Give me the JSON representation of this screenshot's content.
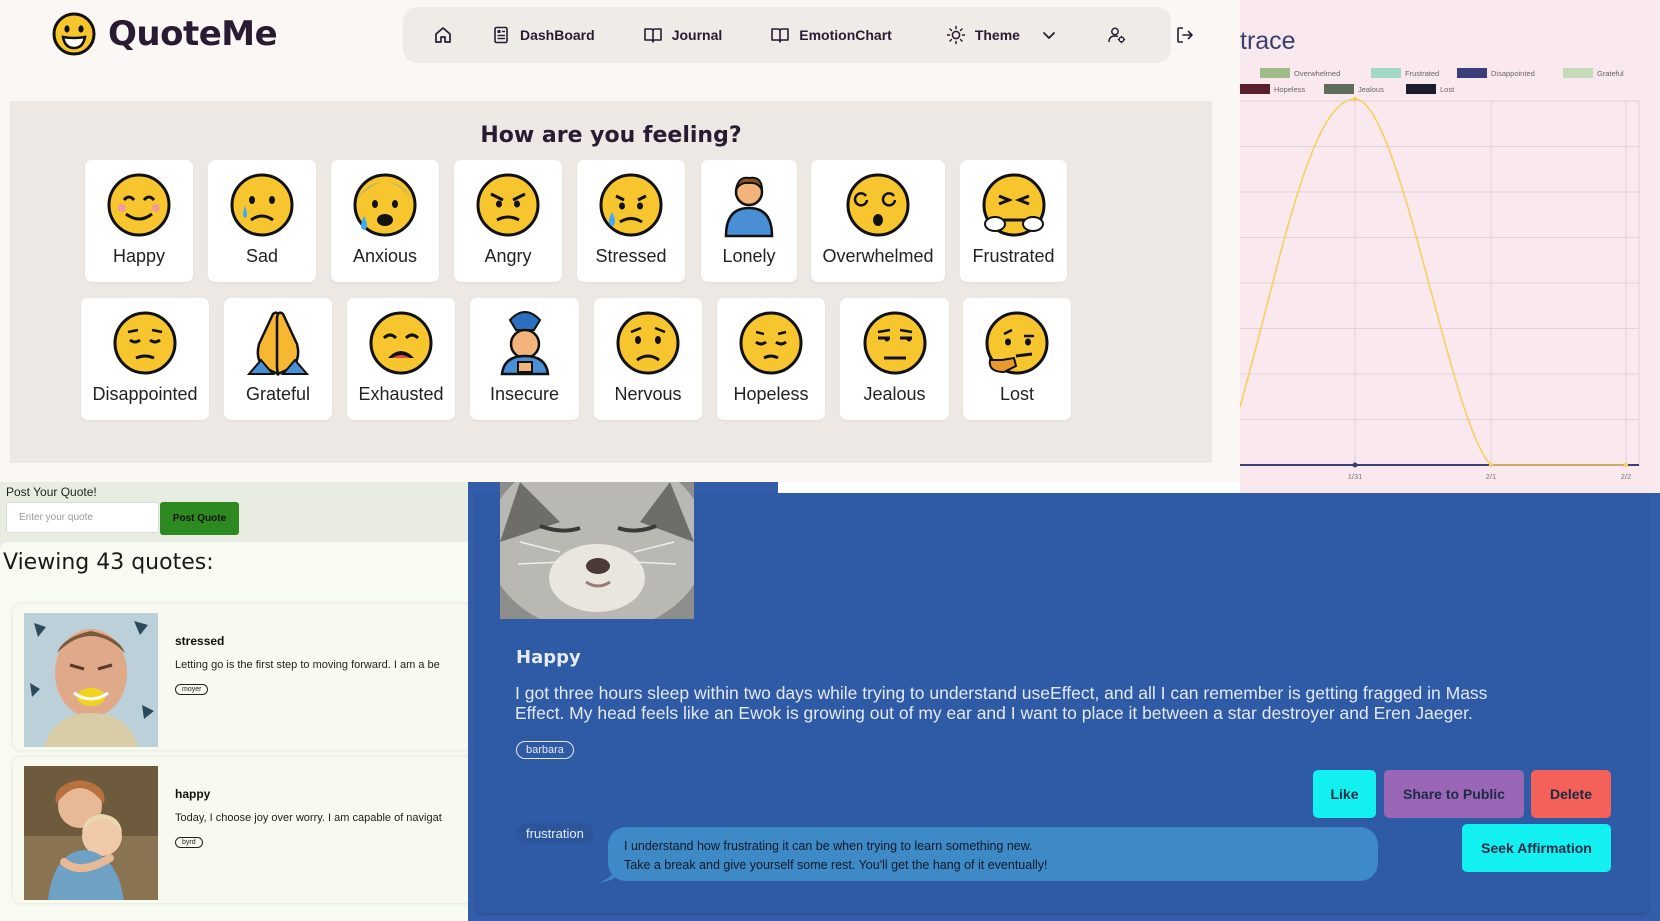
{
  "app": {
    "name": "QuoteMe",
    "nav": {
      "dashboard": "DashBoard",
      "journal": "Journal",
      "emotion_chart": "EmotionChart",
      "theme": "Theme"
    }
  },
  "feelings": {
    "title": "How are you feeling?",
    "emotions": [
      "Happy",
      "Sad",
      "Anxious",
      "Angry",
      "Stressed",
      "Lonely",
      "Overwhelmed",
      "Frustrated",
      "Disappointed",
      "Grateful",
      "Exhausted",
      "Insecure",
      "Nervous",
      "Hopeless",
      "Jealous",
      "Lost"
    ]
  },
  "emotion_chart": {
    "title": "trace",
    "legend": [
      "Overwhelmed",
      "Frustrated",
      "Disappointed",
      "Grateful",
      "Hopeless",
      "Jealous",
      "Lost"
    ],
    "x_ticks": [
      "1/31",
      "2/1",
      "2/2"
    ],
    "colors": {
      "curve": "#f7cf5f",
      "baseline": "#3c3f73",
      "background": "#fae8ef"
    }
  },
  "chart_data": {
    "type": "line",
    "title": "",
    "x": [
      "1/31",
      "2/1",
      "2/2"
    ],
    "series": [
      {
        "name": "Overwhelmed",
        "values": [
          0,
          0,
          0
        ]
      },
      {
        "name": "Frustrated",
        "values": [
          0,
          0,
          0
        ]
      },
      {
        "name": "Disappointed",
        "values": [
          0,
          0,
          0
        ]
      },
      {
        "name": "Grateful",
        "values": [
          0,
          0,
          0
        ]
      },
      {
        "name": "Hopeless",
        "values": [
          0,
          0,
          0
        ]
      },
      {
        "name": "Jealous",
        "values": [
          0,
          0,
          0
        ]
      },
      {
        "name": "Lost",
        "values": [
          0,
          0,
          0
        ]
      }
    ],
    "legend_position": "top",
    "grid": true
  },
  "post": {
    "label": "Post Your Quote!",
    "placeholder": "Enter your quote",
    "button": "Post Quote"
  },
  "feed": {
    "count_text": "Viewing 43 quotes:",
    "quotes": [
      {
        "mood": "stressed",
        "text": "Letting go is the first step to moving forward. I am a be",
        "author": "moyer"
      },
      {
        "mood": "happy",
        "text": "Today, I choose joy over worry. I am capable of navigat",
        "author": "byrd"
      }
    ]
  },
  "detail": {
    "mood": "Happy",
    "text": "I got three hours sleep within two days while trying to understand useEffect, and all I can remember is getting fragged in Mass Effect. My head feels like an Ewok is growing out of my ear and I want to place it between a star destroyer and Eren Jaeger.",
    "author": "barbara",
    "buttons": {
      "like": "Like",
      "share": "Share to Public",
      "delete": "Delete",
      "affirm": "Seek Affirmation"
    },
    "affirmation_tag": "frustration",
    "affirmation_lines": [
      "I understand how frustrating it can be when trying to learn something new.",
      "Take a break and give yourself some rest. You'll get the hang of it eventually!"
    ]
  }
}
